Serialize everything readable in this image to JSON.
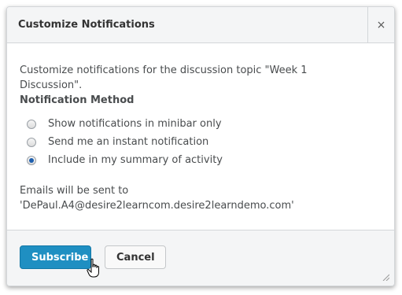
{
  "dialog": {
    "title": "Customize Notifications",
    "close_label": "×"
  },
  "body": {
    "intro": "Customize notifications for the discussion topic \"Week 1 Discussion\".",
    "section_heading": "Notification Method",
    "options": [
      {
        "label": "Show notifications in minibar only",
        "checked": false
      },
      {
        "label": "Send me an instant notification",
        "checked": false
      },
      {
        "label": "Include in my summary of activity",
        "checked": true
      }
    ],
    "email_note_line1": "Emails will be sent to",
    "email_note_line2": "'DePaul.A4@desire2learncom.desire2learndemo.com'"
  },
  "footer": {
    "subscribe_label": "Subscribe",
    "cancel_label": "Cancel"
  },
  "colors": {
    "primary_button": "#1f8fc2",
    "header_bg": "#f4f5f6",
    "radio_selected": "#1e5fae"
  },
  "icons": {
    "close": "close-icon",
    "cursor": "hand-pointer-icon",
    "resize": "resize-grip-icon"
  }
}
